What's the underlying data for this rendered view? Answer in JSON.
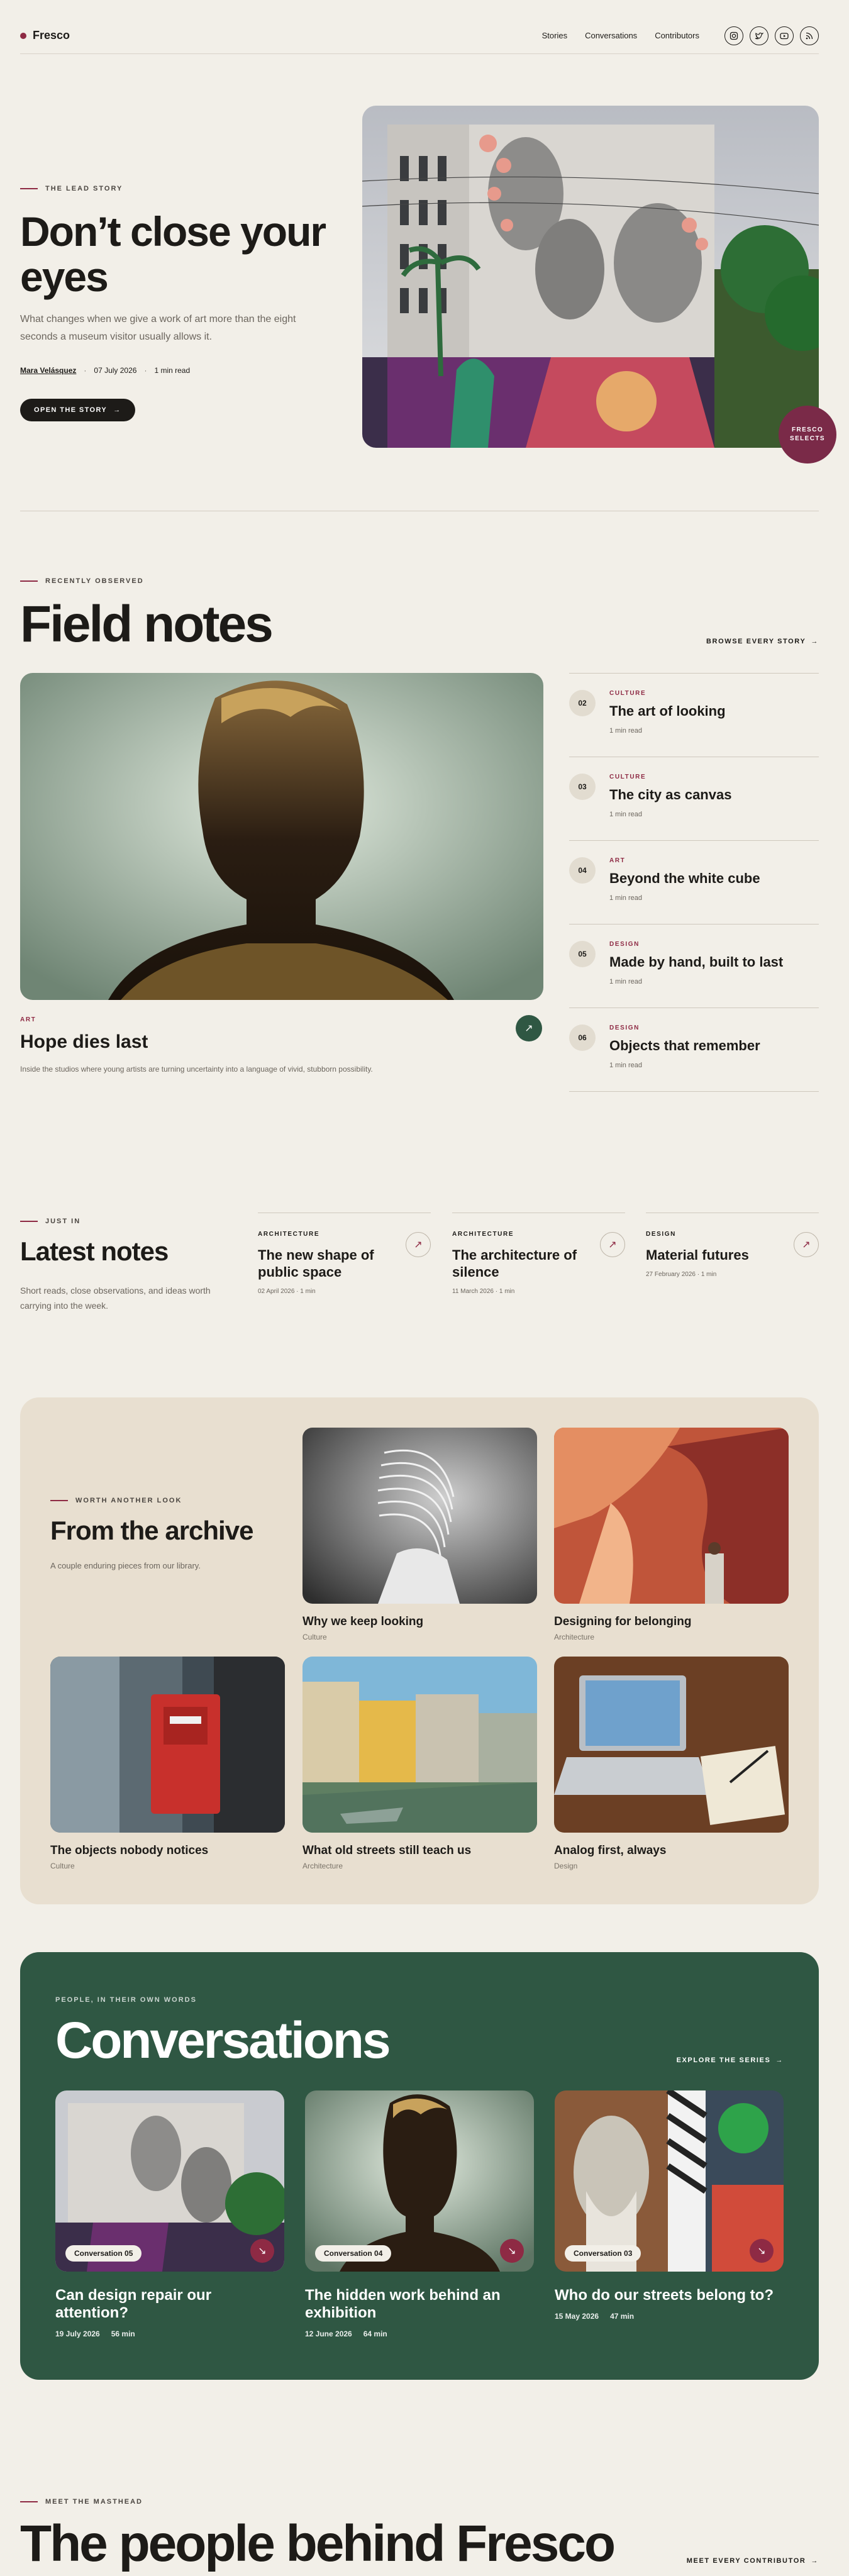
{
  "header": {
    "brand": "Fresco",
    "nav": [
      "Stories",
      "Conversations",
      "Contributors"
    ],
    "socials": [
      "instagram-icon",
      "twitter-icon",
      "youtube-icon",
      "rss-icon"
    ]
  },
  "hero": {
    "eyebrow": "THE LEAD STORY",
    "title": "Don’t close your eyes",
    "dek": "What changes when we give a work of art more than the eight seconds a museum visitor usually allows it.",
    "author": "Mara Velásquez",
    "date": "07 July 2026",
    "read": "1 min read",
    "cta": "OPEN THE STORY",
    "badge": "FRESCO SELECTS"
  },
  "field": {
    "eyebrow": "RECENTLY OBSERVED",
    "title": "Field notes",
    "browse": "BROWSE EVERY STORY",
    "feature": {
      "category": "ART",
      "title": "Hope dies last",
      "dek": "Inside the studios where young artists are turning uncertainty into a language of vivid, stubborn possibility."
    },
    "list": [
      {
        "num": "02",
        "category": "CULTURE",
        "title": "The art of looking",
        "read": "1 min read"
      },
      {
        "num": "03",
        "category": "CULTURE",
        "title": "The city as canvas",
        "read": "1 min read"
      },
      {
        "num": "04",
        "category": "ART",
        "title": "Beyond the white cube",
        "read": "1 min read"
      },
      {
        "num": "05",
        "category": "DESIGN",
        "title": "Made by hand, built to last",
        "read": "1 min read"
      },
      {
        "num": "06",
        "category": "DESIGN",
        "title": "Objects that remember",
        "read": "1 min read"
      }
    ]
  },
  "latest": {
    "eyebrow": "JUST IN",
    "title": "Latest notes",
    "dek": "Short reads, close observations, and ideas worth carrying into the week.",
    "items": [
      {
        "category": "ARCHITECTURE",
        "title": "The new shape of public space",
        "meta": "02 April 2026 · 1 min"
      },
      {
        "category": "ARCHITECTURE",
        "title": "The architecture of silence",
        "meta": "11 March 2026 · 1 min"
      },
      {
        "category": "DESIGN",
        "title": "Material futures",
        "meta": "27 February 2026 · 1 min"
      }
    ]
  },
  "archive": {
    "eyebrow": "WORTH ANOTHER LOOK",
    "title": "From the archive",
    "dek": "A couple enduring pieces from our library.",
    "items": [
      {
        "title": "Why we keep looking",
        "category": "Culture"
      },
      {
        "title": "Designing for belonging",
        "category": "Architecture"
      },
      {
        "title": "The objects nobody notices",
        "category": "Culture"
      },
      {
        "title": "What old streets still teach us",
        "category": "Architecture"
      },
      {
        "title": "Analog first, always",
        "category": "Design"
      }
    ]
  },
  "conversations": {
    "eyebrow": "PEOPLE, IN THEIR OWN WORDS",
    "title": "Conversations",
    "explore": "EXPLORE THE SERIES",
    "items": [
      {
        "label": "Conversation 05",
        "title": "Can design repair our attention?",
        "date": "19 July 2026",
        "duration": "56 min"
      },
      {
        "label": "Conversation 04",
        "title": "The hidden work behind an exhibition",
        "date": "12 June 2026",
        "duration": "64 min"
      },
      {
        "label": "Conversation 03",
        "title": "Who do our streets belong to?",
        "date": "15 May 2026",
        "duration": "47 min"
      }
    ]
  },
  "masthead": {
    "eyebrow": "MEET THE MASTHEAD",
    "title": "The people behind Fresco",
    "cta": "MEET EVERY CONTRIBUTOR"
  }
}
